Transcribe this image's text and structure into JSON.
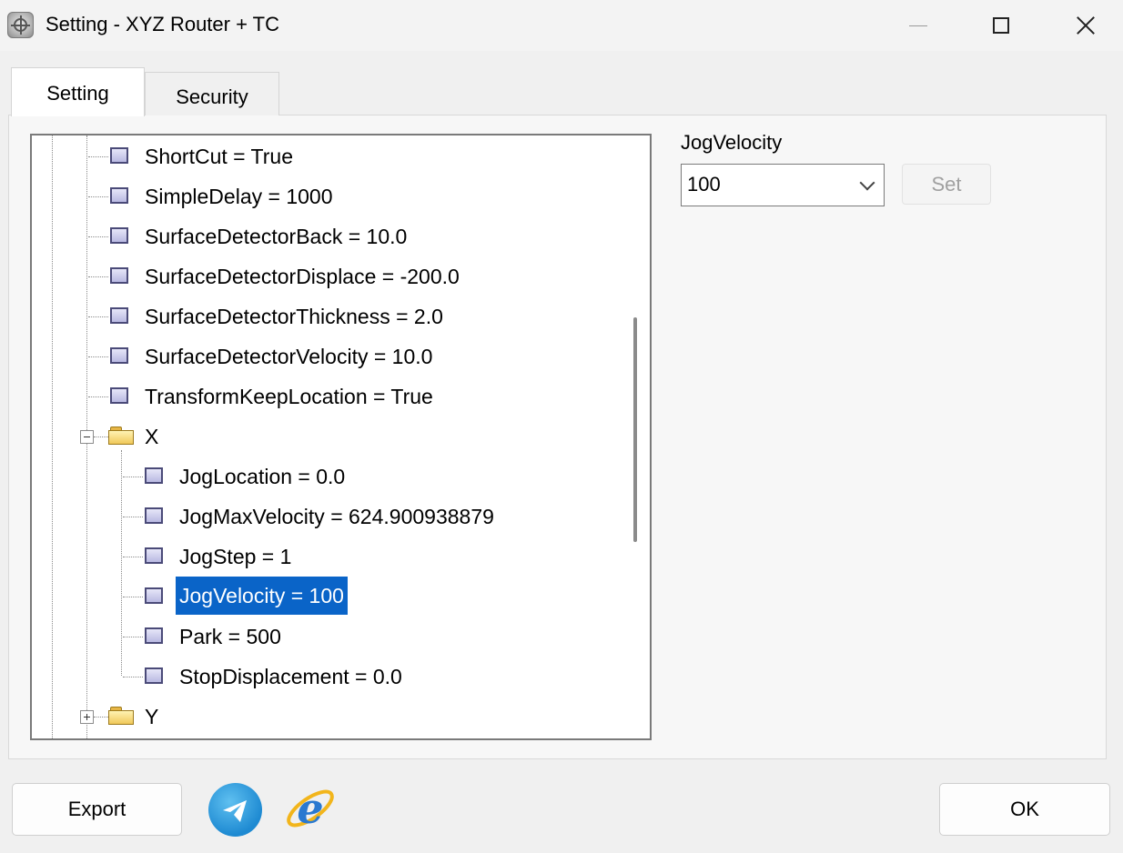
{
  "window": {
    "title": "Setting - XYZ Router + TC",
    "controls": [
      "minimize-icon",
      "maximize-icon",
      "close-icon"
    ]
  },
  "tabs": [
    {
      "label": "Setting",
      "active": true
    },
    {
      "label": "Security",
      "active": false
    }
  ],
  "tree": {
    "items": [
      {
        "label": "ShortCut = True",
        "type": "leaf",
        "level": 1
      },
      {
        "label": "SimpleDelay = 1000",
        "type": "leaf",
        "level": 1
      },
      {
        "label": "SurfaceDetectorBack = 10.0",
        "type": "leaf",
        "level": 1
      },
      {
        "label": "SurfaceDetectorDisplace = -200.0",
        "type": "leaf",
        "level": 1
      },
      {
        "label": "SurfaceDetectorThickness = 2.0",
        "type": "leaf",
        "level": 1
      },
      {
        "label": "SurfaceDetectorVelocity = 10.0",
        "type": "leaf",
        "level": 1
      },
      {
        "label": "TransformKeepLocation = True",
        "type": "leaf",
        "level": 1
      },
      {
        "label": "X",
        "type": "folder",
        "expanded": true,
        "level": 1
      },
      {
        "label": "JogLocation = 0.0",
        "type": "leaf",
        "level": 2
      },
      {
        "label": "JogMaxVelocity = 624.900938879",
        "type": "leaf",
        "level": 2
      },
      {
        "label": "JogStep = 1",
        "type": "leaf",
        "level": 2
      },
      {
        "label": "JogVelocity = 100",
        "type": "leaf",
        "level": 2,
        "selected": true
      },
      {
        "label": "Park = 500",
        "type": "leaf",
        "level": 2
      },
      {
        "label": "StopDisplacement = 0.0",
        "type": "leaf",
        "level": 2
      },
      {
        "label": "Y",
        "type": "folder",
        "expanded": false,
        "level": 1
      }
    ],
    "selection_color": "#0a64c8"
  },
  "editor": {
    "property_label": "JogVelocity",
    "value": "100",
    "set_label": "Set",
    "set_enabled": false
  },
  "footer": {
    "export_label": "Export",
    "ok_label": "OK",
    "icons": [
      "telegram-icon",
      "internet-explorer-icon"
    ]
  }
}
